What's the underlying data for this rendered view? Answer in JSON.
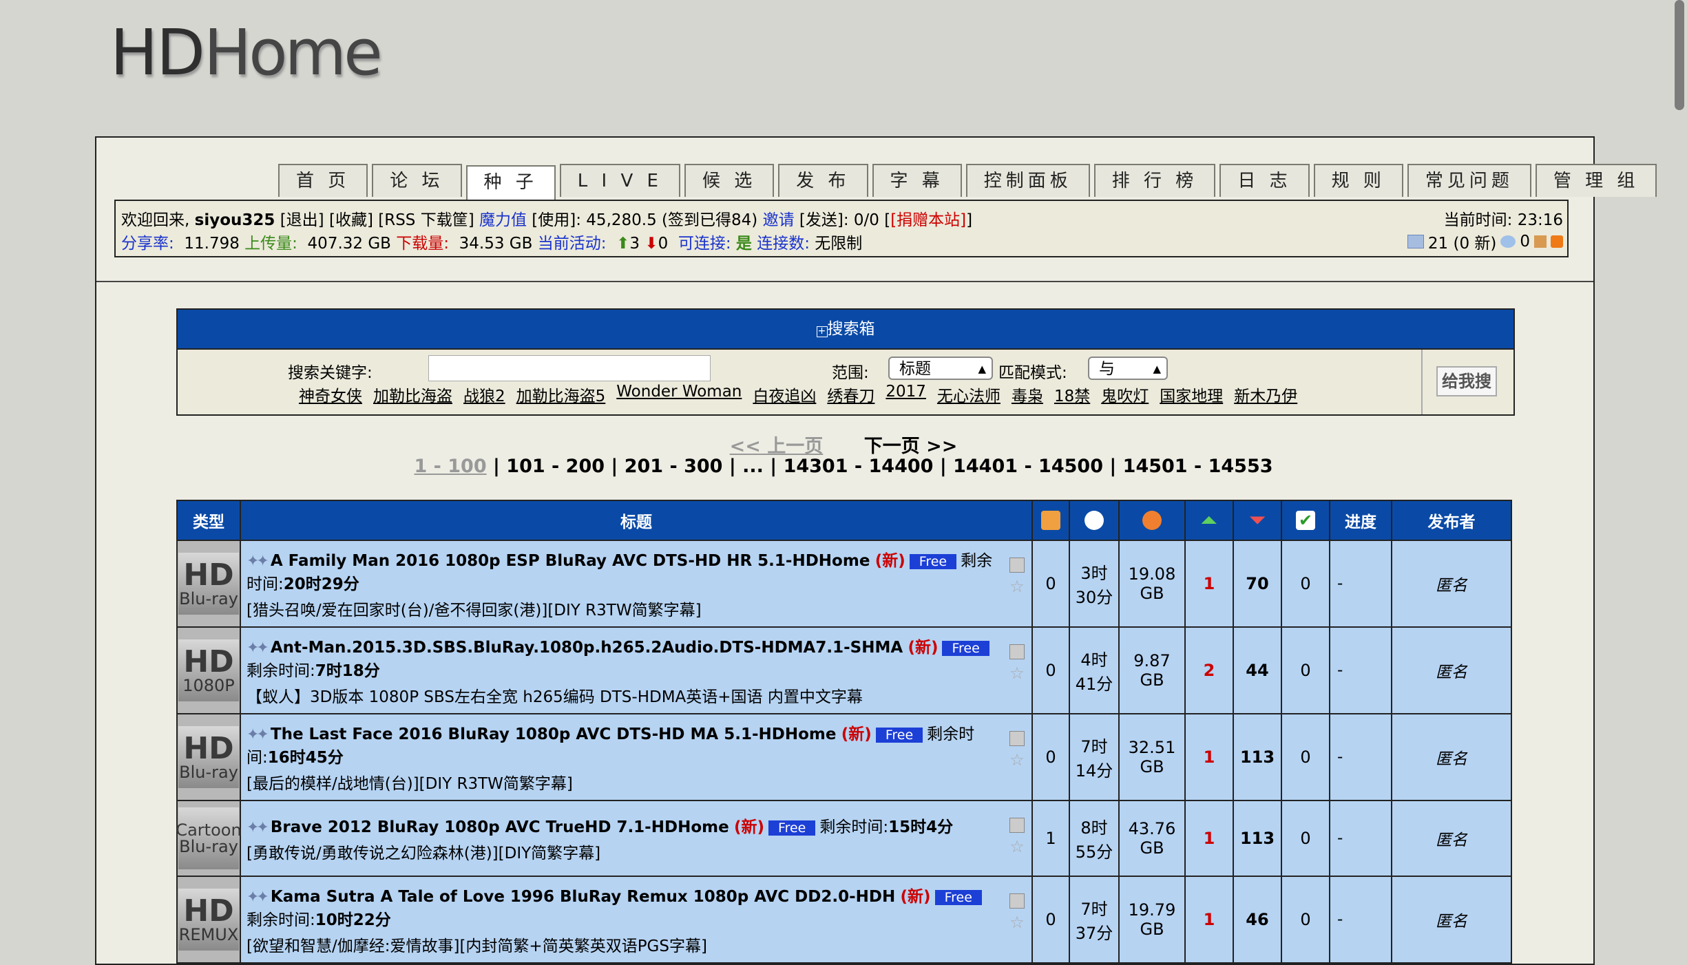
{
  "logo": {
    "part1": "HD",
    "part2": "Home"
  },
  "nav": [
    "首 页",
    "论 坛",
    "种 子",
    "L I V E",
    "候 选",
    "发 布",
    "字 幕",
    "控制面板",
    "排 行 榜",
    "日 志",
    "规 则",
    "常见问题",
    "管 理 组"
  ],
  "nav_active": "种 子",
  "userbar": {
    "welcome": "欢迎回来,",
    "username": "siyou325",
    "logout": "[退出]",
    "favorites": "[收藏]",
    "rss": "[RSS 下载筐]",
    "magic_label": "魔力值",
    "usage": "[使用]: 45,280.5 (签到已得84)",
    "invite_label": "邀请",
    "sent": "[发送]: 0/0",
    "donate": "[捐赠本站]",
    "time_label": "当前时间:",
    "time_value": "23:16",
    "ratio_label": "分享率:",
    "ratio_value": "11.798",
    "upload_label": "上传量:",
    "upload_value": "407.32 GB",
    "download_label": "下载量:",
    "download_value": "34.53 GB",
    "active_label": "当前活动:",
    "active_up": "3",
    "active_down": "0",
    "connectable_label": "可连接:",
    "connectable_value": "是",
    "connections_label": "连接数:",
    "connections_value": "无限制",
    "messages": "21 (0 新)",
    "friends": "0"
  },
  "search": {
    "title": "搜索箱",
    "keyword_label": "搜索关键字:",
    "keyword_value": "",
    "scope_label": "范围:",
    "scope_value": "标题",
    "mode_label": "匹配模式:",
    "mode_value": "与",
    "submit": "给我搜",
    "hot": [
      "神奇女侠",
      "加勒比海盗",
      "战狼2",
      "加勒比海盗5",
      "Wonder Woman",
      "白夜追凶",
      "绣春刀",
      "2017",
      "无心法师",
      "毒枭",
      "18禁",
      "鬼吹灯",
      "国家地理",
      "新木乃伊"
    ]
  },
  "pager": {
    "prev": "<< 上一页",
    "next": "下一页 >>",
    "current": "1 - 100",
    "pages": [
      "101 - 200",
      "201 - 300",
      "...",
      "14301 - 14400",
      "14401 - 14500",
      "14501 - 14553"
    ]
  },
  "table": {
    "headers": {
      "type": "类型",
      "title": "标题",
      "progress": "进度",
      "uploader": "发布者"
    },
    "header_icons": [
      "comments-icon",
      "clock-icon",
      "size-icon",
      "seeders-icon",
      "leechers-icon",
      "completed-icon"
    ],
    "rows": [
      {
        "cat1": "HD",
        "cat2": "Blu-ray",
        "name": "A Family Man 2016 1080p ESP BluRay AVC DTS-HD HR 5.1-HDHome",
        "new": "(新)",
        "free": "Free",
        "remain_label": "剩余时间:",
        "remain": "20时29分",
        "sub": "[猎头召唤/爱在回家时(台)/爸不得回家(港)][DIY R3TW简繁字幕]",
        "comments": "0",
        "age1": "3时",
        "age2": "30分",
        "size1": "19.08",
        "size2": "GB",
        "seeders": "1",
        "leechers": "70",
        "completed": "0",
        "progress": "-",
        "uploader": "匿名"
      },
      {
        "cat1": "HD",
        "cat2": "1080P",
        "name": "Ant-Man.2015.3D.SBS.BluRay.1080p.h265.2Audio.DTS-HDMA7.1-SHMA",
        "new": "(新)",
        "free": "Free",
        "remain_label": "剩余时间:",
        "remain": "7时18分",
        "sub": "【蚁人】3D版本 1080P SBS左右全宽 h265编码 DTS-HDMA英语+国语 内置中文字幕",
        "comments": "0",
        "age1": "4时",
        "age2": "41分",
        "size1": "9.87",
        "size2": "GB",
        "seeders": "2",
        "leechers": "44",
        "completed": "0",
        "progress": "-",
        "uploader": "匿名"
      },
      {
        "cat1": "HD",
        "cat2": "Blu-ray",
        "name": "The Last Face 2016 BluRay 1080p AVC DTS-HD MA 5.1-HDHome",
        "new": "(新)",
        "free": "Free",
        "remain_label": "剩余时间:",
        "remain": "16时45分",
        "sub": "[最后的模样/战地情(台)][DIY R3TW简繁字幕]",
        "comments": "0",
        "age1": "7时",
        "age2": "14分",
        "size1": "32.51",
        "size2": "GB",
        "seeders": "1",
        "leechers": "113",
        "completed": "0",
        "progress": "-",
        "uploader": "匿名"
      },
      {
        "cat1": "Cartoon",
        "cat2": "Blu-ray",
        "name": "Brave 2012 BluRay 1080p AVC TrueHD 7.1-HDHome",
        "new": "(新)",
        "free": "Free",
        "remain_label": "剩余时间:",
        "remain": "15时4分",
        "sub": "[勇敢传说/勇敢传说之幻险森林(港)][DIY简繁字幕]",
        "comments": "1",
        "age1": "8时",
        "age2": "55分",
        "size1": "43.76",
        "size2": "GB",
        "seeders": "1",
        "leechers": "113",
        "completed": "0",
        "progress": "-",
        "uploader": "匿名"
      },
      {
        "cat1": "HD",
        "cat2": "REMUX",
        "name": "Kama Sutra A Tale of Love 1996 BluRay Remux 1080p AVC DD2.0-HDH",
        "new": "(新)",
        "free": "Free",
        "remain_label": "剩余时间:",
        "remain": "10时22分",
        "sub": "[欲望和智慧/伽摩经:爱情故事][内封简繁+简英繁英双语PGS字幕]",
        "comments": "0",
        "age1": "7时",
        "age2": "37分",
        "size1": "19.79",
        "size2": "GB",
        "seeders": "1",
        "leechers": "46",
        "completed": "0",
        "progress": "-",
        "uploader": "匿名"
      }
    ]
  }
}
